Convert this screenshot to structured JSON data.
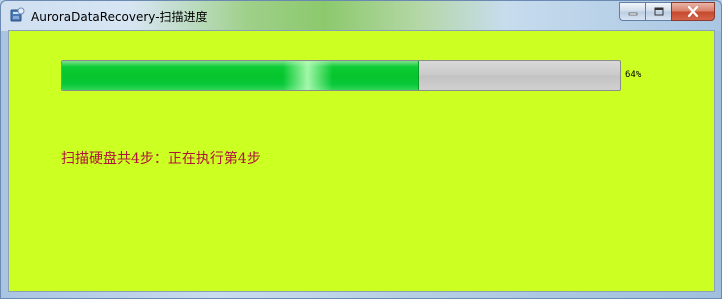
{
  "window": {
    "title": "AuroraDataRecovery-扫描进度"
  },
  "progress": {
    "value": 0.64,
    "percent_label": "64%"
  },
  "status": {
    "message": "扫描硬盘共4步：正在执行第4步"
  },
  "colors": {
    "client_background": "#ccff22",
    "progress_fill": "#05c42c",
    "progress_track": "#c9c9c9",
    "status_text": "#b0143c"
  }
}
